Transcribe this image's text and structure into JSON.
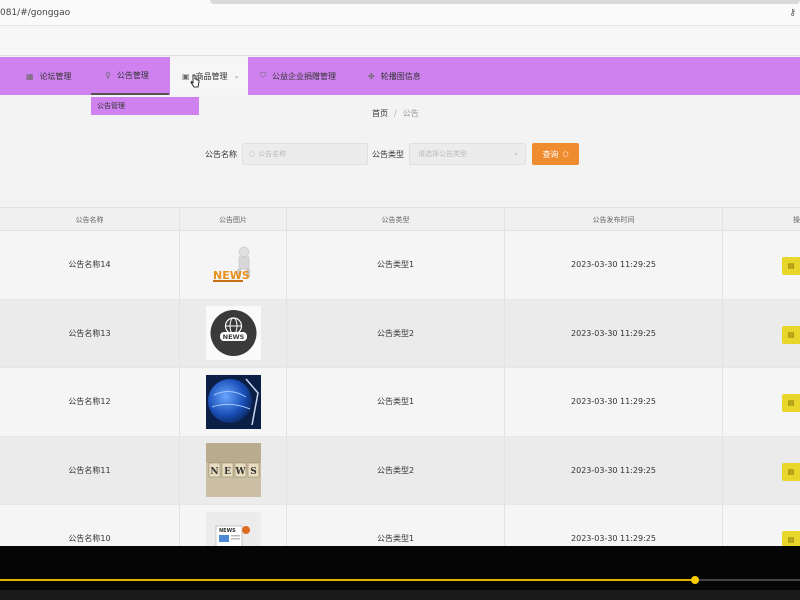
{
  "browser": {
    "url": "081/#/gonggao",
    "key_icon": "key-icon"
  },
  "nav": {
    "items": [
      {
        "label": "论坛管理",
        "icon": "forum-icon"
      },
      {
        "label": "公告管理",
        "icon": "bulb-icon"
      },
      {
        "label": "商品管理",
        "icon": "goods-icon"
      },
      {
        "label": "公益企业捐赠管理",
        "icon": "shield-icon"
      },
      {
        "label": "轮播图信息",
        "icon": "gear-icon"
      }
    ],
    "submenu_label": "公告管理",
    "accent": "#cf82ef"
  },
  "breadcrumb": {
    "home": "首页",
    "separator": "/",
    "current": "公告"
  },
  "search": {
    "name_label": "公告名称",
    "name_placeholder": "公告名称",
    "type_label": "公告类型",
    "type_placeholder": "请选择公告类型",
    "query_label": "查询",
    "query_color": "#f08c30"
  },
  "table": {
    "headers": [
      "公告名称",
      "公告图片",
      "公告类型",
      "公告发布时间",
      "操"
    ],
    "rows": [
      {
        "name": "公告名称14",
        "image": "news-3d-figure",
        "type": "公告类型1",
        "time": "2023-03-30 11:29:25"
      },
      {
        "name": "公告名称13",
        "image": "news-globe-badge",
        "type": "公告类型2",
        "time": "2023-03-30 11:29:25"
      },
      {
        "name": "公告名称12",
        "image": "blue-globe",
        "type": "公告类型1",
        "time": "2023-03-30 11:29:25"
      },
      {
        "name": "公告名称11",
        "image": "news-wooden-blocks",
        "type": "公告类型2",
        "time": "2023-03-30 11:29:25"
      },
      {
        "name": "公告名称10",
        "image": "news-document",
        "type": "公告类型1",
        "time": "2023-03-30 11:29:25"
      }
    ],
    "detail_color": "#e8d72a"
  },
  "video": {
    "progress_color": "#e0b400"
  }
}
